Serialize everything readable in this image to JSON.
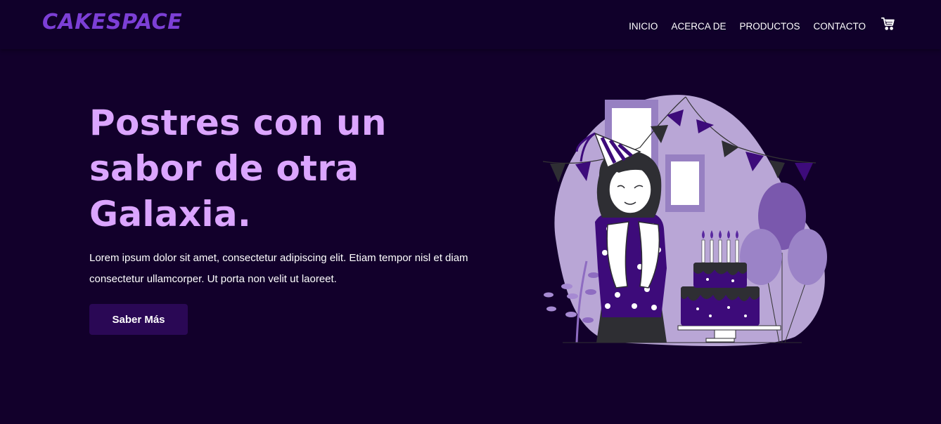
{
  "brand": {
    "logo": "CAKESPACE"
  },
  "nav": {
    "items": [
      {
        "label": "INICIO"
      },
      {
        "label": "ACERCA DE"
      },
      {
        "label": "PRODUCTOS"
      },
      {
        "label": "CONTACTO"
      }
    ],
    "cart_icon": "cart-icon"
  },
  "hero": {
    "title_line1": "Postres con un",
    "title_line2": "sabor de otra",
    "title_line3": "Galaxia.",
    "description": "Lorem ipsum dolor sit amet, consectetur adipiscing elit. Etiam tempor nisl et diam consectetur ullamcorper. Ut porta non velit ut laoreet.",
    "cta_label": "Saber Más"
  },
  "colors": {
    "background": "#12002b",
    "accent": "#7c3fd6",
    "title": "#dba5ff",
    "button": "#2a0855"
  }
}
